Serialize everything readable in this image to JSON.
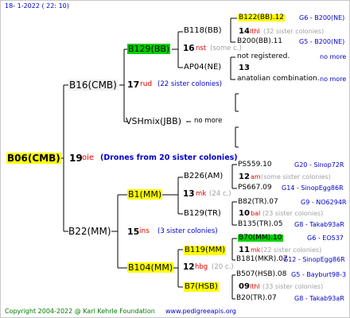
{
  "header": {
    "date": "18-  1-2022 ( 22: 10)"
  },
  "footer": {
    "copyright": "Copyright 2004-2022 @ Karl Kehrle Foundation",
    "site": "www.pedigreeapis.org"
  },
  "root": {
    "label": "B06(CMB)",
    "number": "19",
    "mark": "oie",
    "note": "(Drones from 20 sister colonies)"
  },
  "gen1": [
    {
      "label": "B16(CMB)",
      "number": "17",
      "mark": "rud",
      "note": "(22 sister colonies)"
    },
    {
      "label": "B22(MM)",
      "number": "15",
      "mark": "ins",
      "note": "(3 sister colonies)"
    }
  ],
  "gen2": [
    {
      "label": "B129(BB)",
      "number": "16",
      "mark": "nst",
      "note": "(some c.)"
    },
    {
      "label": "VSHmix(JBB)",
      "number": "",
      "mark": "",
      "note": "no more"
    },
    {
      "label": "B1(MM)",
      "number": "13",
      "mark": "mk",
      "note": "(24 c.)"
    },
    {
      "label": "B104(MM)",
      "number": "12",
      "mark": "hbg",
      "note": "(20 c.)"
    }
  ],
  "gen3": [
    {
      "label": "B118(BB)",
      "number": "14",
      "mark": "lthl",
      "note": "(32 sister colonies)"
    },
    {
      "label": "AP04(NE)",
      "number": "13",
      "mark": "",
      "note": ""
    },
    {
      "label": "B226(AM)",
      "number": "12",
      "mark": "am",
      "note": "(some sister colonies)"
    },
    {
      "label": "B129(TR)",
      "number": "10",
      "mark": "bal",
      "note": "(23 sister colonies)"
    },
    {
      "label": "B119(MM)",
      "number": "11",
      "mark": "mk",
      "note": "(22 sister colonies)"
    },
    {
      "label": "B7(HSB)",
      "number": "09",
      "mark": "lthl",
      "note": "(33 sister colonies)"
    }
  ],
  "gen4": [
    {
      "label": "B122(BB).12",
      "ref": "G6 - B200(NE)"
    },
    {
      "label": "B200(BB).11",
      "ref": "G5 - B200(NE)"
    },
    {
      "label": "not registered.",
      "ref": "no more"
    },
    {
      "label": "anatolian combination.",
      "ref": "no more"
    },
    {
      "label": "PS559.10",
      "ref": "G20 - Sinop72R"
    },
    {
      "label": "PS667.09",
      "ref": "G14 - SinopEgg86R"
    },
    {
      "label": "B82(TR).07",
      "ref": "G9 - NO6294R"
    },
    {
      "label": "B135(TR).05",
      "ref": "G8 - Takab93aR"
    },
    {
      "label": "B70(MM).10",
      "ref": "G6 - EO537"
    },
    {
      "label": "B181(MKR).07",
      "ref": "G12 - SinopEgg86R"
    },
    {
      "label": "B507(HSB).08",
      "ref": "G5 - Bayburt98-3"
    },
    {
      "label": "B20(TR).07",
      "ref": "G8 - Takab93aR"
    }
  ]
}
